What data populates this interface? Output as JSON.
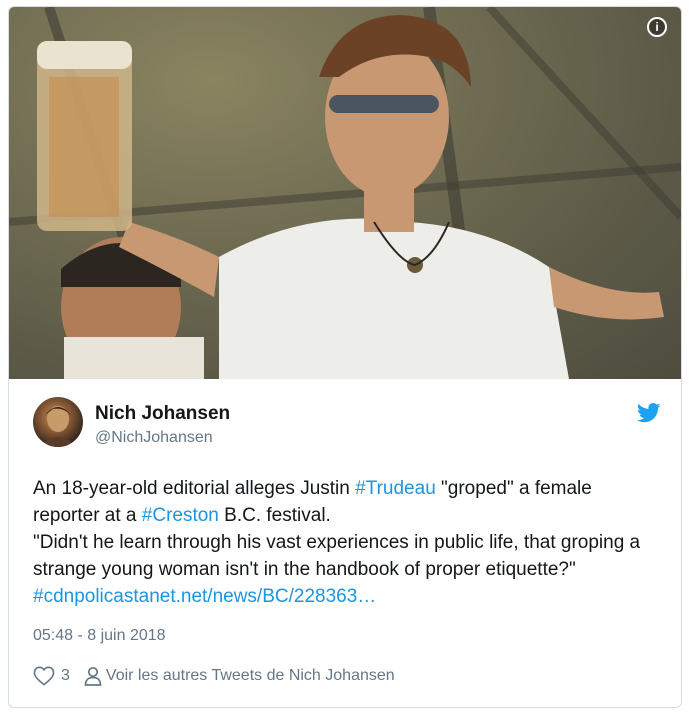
{
  "colors": {
    "link": "#1b95e0",
    "secondary": "#657786",
    "twitter_blue": "#1da1f2"
  },
  "media": {
    "info_icon": "info-icon"
  },
  "author": {
    "name": "Nich Johansen",
    "handle": "@NichJohansen"
  },
  "tweet": {
    "line1_before": "An 18-year-old editorial alleges Justin ",
    "hashtag1": "#Trudeau",
    "line1_after": " \"groped\" a female reporter at a ",
    "hashtag2": "#Creston",
    "line1_end": " B.C. festival.",
    "line2": "\"Didn't he learn through his vast experiences in public life, that groping a strange young woman isn't in the handbook of proper etiquette?\" ",
    "link": "#cdnpolicastanet.net/news/BC/228363…",
    "timestamp": "05:48 - 8 juin 2018"
  },
  "actions": {
    "like_count": "3",
    "more_label": "Voir les autres Tweets de Nich Johansen"
  }
}
